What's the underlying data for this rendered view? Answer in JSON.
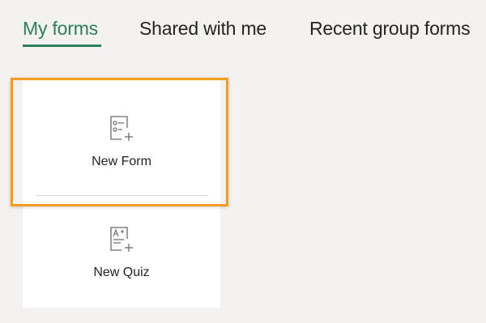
{
  "tabs": [
    {
      "label": "My forms",
      "active": true
    },
    {
      "label": "Shared with me",
      "active": false
    },
    {
      "label": "Recent group forms",
      "active": false
    }
  ],
  "cards": {
    "new_form": {
      "label": "New Form",
      "icon": "form-list-add-icon"
    },
    "new_quiz": {
      "label": "New Quiz",
      "icon": "quiz-add-icon"
    }
  },
  "colors": {
    "accent": "#2e7d5b",
    "highlight": "#f39c1f",
    "background": "#f3f2f1",
    "icon": "#6b6b6b"
  }
}
